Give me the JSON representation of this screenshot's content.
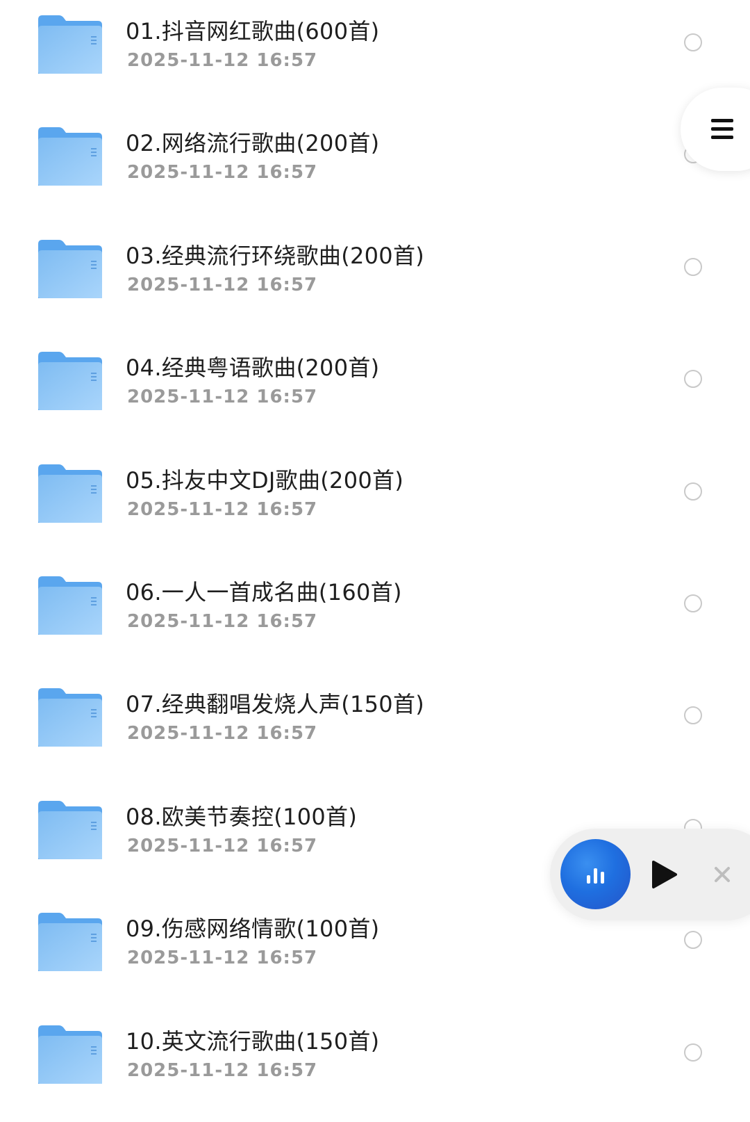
{
  "folders": [
    {
      "name": "01.抖音网红歌曲(600首)",
      "date": "2025-11-12 16:57"
    },
    {
      "name": "02.网络流行歌曲(200首)",
      "date": "2025-11-12 16:57"
    },
    {
      "name": "03.经典流行环绕歌曲(200首)",
      "date": "2025-11-12 16:57"
    },
    {
      "name": "04.经典粤语歌曲(200首)",
      "date": "2025-11-12 16:57"
    },
    {
      "name": "05.抖友中文DJ歌曲(200首)",
      "date": "2025-11-12 16:57"
    },
    {
      "name": "06.一人一首成名曲(160首)",
      "date": "2025-11-12 16:57"
    },
    {
      "name": "07.经典翻唱发烧人声(150首)",
      "date": "2025-11-12 16:57"
    },
    {
      "name": "08.欧美节奏控(100首)",
      "date": "2025-11-12 16:57"
    },
    {
      "name": "09.伤感网络情歌(100首)",
      "date": "2025-11-12 16:57"
    },
    {
      "name": "10.英文流行歌曲(150首)",
      "date": "2025-11-12 16:57"
    }
  ],
  "icons": {
    "folder": "folder-icon",
    "select": "radio-circle-icon",
    "menu": "hamburger-menu-icon",
    "now_playing": "equalizer-bars-icon",
    "play": "play-icon",
    "close": "close-icon"
  },
  "colors": {
    "folder_front": "#8cc4f4",
    "folder_back": "#5aa6ee",
    "title_text": "#1e1e1e",
    "date_text": "#9a9a9a",
    "player_disc": "#1f6fe0"
  }
}
